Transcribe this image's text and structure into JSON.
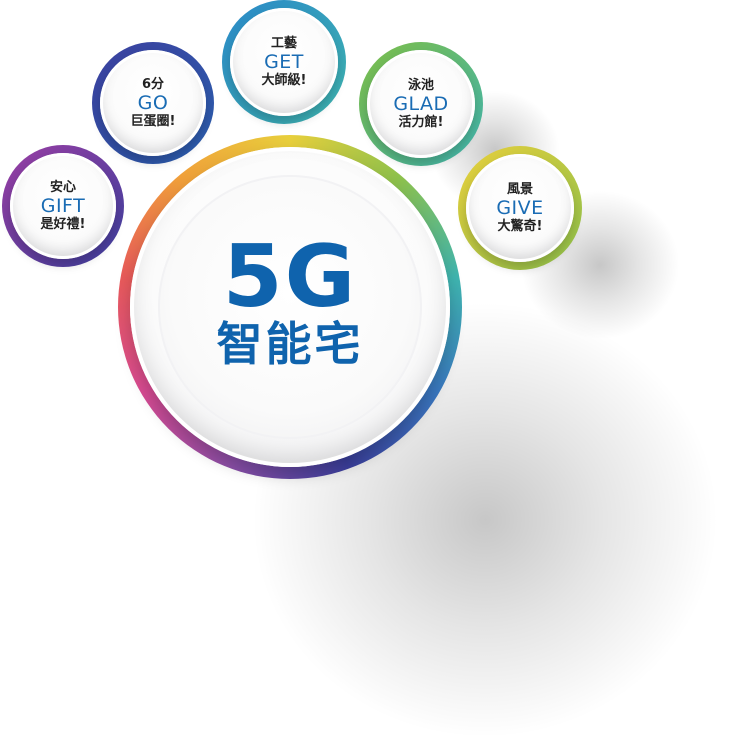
{
  "main": {
    "title": "5G",
    "subtitle": "智能宅",
    "ring_colors": [
      "#8b4fa8",
      "#d94b93",
      "#e85a5a",
      "#f0a03a",
      "#e8cf3c",
      "#8ec14b",
      "#3fb5b0",
      "#3a78c0",
      "#3b3f9c"
    ]
  },
  "bubbles": [
    {
      "top": "安心",
      "mid": "GIFT",
      "bottom": "是好禮!",
      "ring": [
        "#9b3ea3",
        "#3c3f9e"
      ]
    },
    {
      "top": "6分",
      "mid": "GO",
      "bottom": "巨蛋圈!",
      "ring": [
        "#3c3f9e",
        "#2a5fae"
      ]
    },
    {
      "top": "工藝",
      "mid": "GET",
      "bottom": "大師級!",
      "ring": [
        "#2a88c8",
        "#3fb5b0"
      ]
    },
    {
      "top": "泳池",
      "mid": "GLAD",
      "bottom": "活力館!",
      "ring": [
        "#7ebd45",
        "#3fb5b0"
      ]
    },
    {
      "top": "風景",
      "mid": "GIVE",
      "bottom": "大驚奇!",
      "ring": [
        "#e8cf3c",
        "#8ec14b"
      ]
    }
  ]
}
